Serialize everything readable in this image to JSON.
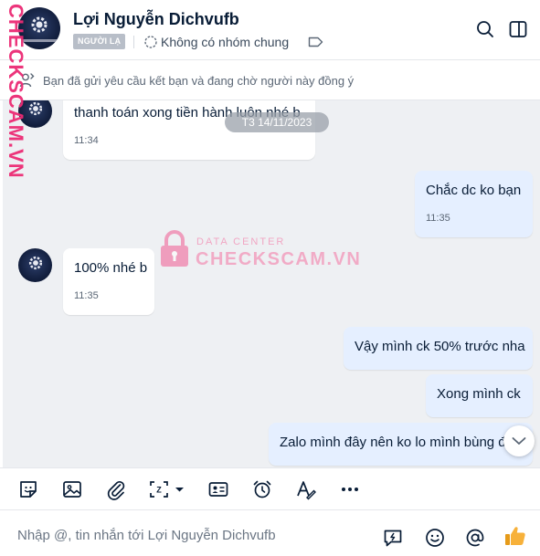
{
  "header": {
    "name": "Lợi Nguyễn Dichvufb",
    "badge": "NGƯỜI LẠ",
    "group_text": "Không có nhóm chung"
  },
  "notice": {
    "text": "Bạn đã gửi yêu cầu kết bạn và đang chờ người này đồng ý"
  },
  "chat": {
    "date_chip": "T3 14/11/2023",
    "messages": [
      {
        "side": "in",
        "text": "thanh toán xong tiền hành luôn nhé b",
        "time": "11:34"
      },
      {
        "side": "out",
        "text": "Chắc dc ko bạn",
        "time": "11:35"
      },
      {
        "side": "in",
        "text": "100% nhé b",
        "time": "11:35"
      },
      {
        "side": "out",
        "text": "Vậy mình ck 50% trước nha",
        "time": ""
      },
      {
        "side": "out",
        "text": "Xong mình ck",
        "time": ""
      },
      {
        "side": "out",
        "text": "Zalo mình đây nên ko lo mình bùng đâu",
        "time": ""
      }
    ]
  },
  "watermark": {
    "side": "CHECKSCAM.VN",
    "top": "DATA CENTER",
    "main": "CHECKSCAM.VN"
  },
  "composer": {
    "placeholder": "Nhập @, tin nhắn tới Lợi Nguyễn Dichvufb"
  },
  "icons": {
    "toolbar": [
      "sticker-icon",
      "image-icon",
      "attachment-icon",
      "screenshot-icon",
      "business-card-icon",
      "reminder-icon",
      "text-format-icon",
      "more-icon"
    ],
    "composer": [
      "quick-message-icon",
      "emoji-icon",
      "mention-icon",
      "thumbs-up-icon"
    ]
  },
  "colors": {
    "accent": "#0068ff",
    "outgoing_bubble": "#e5efff",
    "chat_background": "#eef0f3",
    "thumbs_up": "#f5a623",
    "watermark": "#ec2b74"
  }
}
